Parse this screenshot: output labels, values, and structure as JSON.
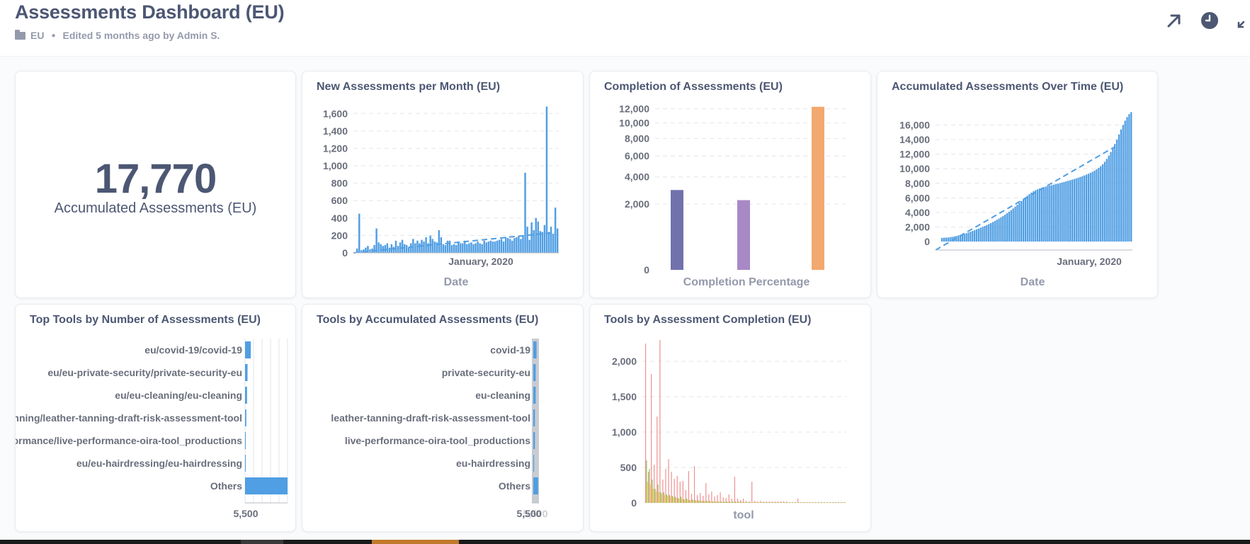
{
  "dashboard": {
    "title": "Assessments Dashboard (EU)",
    "collection": "EU",
    "edited": "Edited 5 months ago by Admin S."
  },
  "header_icons": [
    "arrow-up-right-icon",
    "clock-icon",
    "fullscreen-icon"
  ],
  "colors": {
    "accent": "#509ee3",
    "text": "#4c5773",
    "muted": "#949aab",
    "purple": "#7172ad",
    "lilac": "#a989c5",
    "orange": "#f2a86f",
    "red": "#ef8c8c",
    "green": "#88bf4d",
    "yellow": "#f9d45c"
  },
  "scalar": {
    "value": "17,770",
    "label": "Accumulated Assessments (EU)"
  },
  "charts": {
    "new_per_month": {
      "title": "New Assessments per Month (EU)",
      "xlabel": "Date",
      "x_tick": "January, 2020",
      "y_ticks": [
        "0",
        "200",
        "400",
        "600",
        "800",
        "1,000",
        "1,200",
        "1,400",
        "1,600"
      ]
    },
    "completion": {
      "title": "Completion of Assessments (EU)",
      "xlabel": "Completion Percentage",
      "y_ticks": [
        "0",
        "2,000",
        "4,000",
        "6,000",
        "8,000",
        "10,000",
        "12,000"
      ]
    },
    "accumulated": {
      "title": "Accumulated Assessments Over Time (EU)",
      "xlabel": "Date",
      "x_tick": "January, 2020",
      "y_ticks": [
        "0",
        "2,000",
        "4,000",
        "6,000",
        "8,000",
        "10,000",
        "12,000",
        "14,000",
        "16,000"
      ]
    },
    "top_tools": {
      "title": "Top Tools by Number of Assessments (EU)",
      "labels": [
        "eu/covid-19/covid-19",
        "eu/eu-private-security/private-security-eu",
        "eu/eu-cleaning/eu-cleaning",
        "eu/leather-tanning/leather-tanning-draft-risk-assessment-tool",
        "eu/live-performance/live-performance-oira-tool_productions",
        "eu/eu-hairdressing/eu-hairdressing",
        "Others"
      ],
      "x_tick": "5,500"
    },
    "tools_accumulated": {
      "title": "Tools by Accumulated Assessments (EU)",
      "labels": [
        "covid-19",
        "private-security-eu",
        "eu-cleaning",
        "leather-tanning-draft-risk-assessment-tool",
        "live-performance-oira-tool_productions",
        "eu-hairdressing",
        "Others"
      ],
      "x_tick": "5,500"
    },
    "tools_completion": {
      "title": "Tools by Assessment Completion (EU)",
      "xlabel": "tool",
      "y_ticks": [
        "0",
        "500",
        "1,000",
        "1,500",
        "2,000"
      ]
    }
  },
  "chart_data": [
    {
      "type": "bar",
      "title": "New Assessments per Month (EU)",
      "xlabel": "Date",
      "ylabel": "",
      "ylim": [
        0,
        1700
      ],
      "trend_line": true,
      "values": [
        50,
        450,
        30,
        40,
        60,
        80,
        40,
        50,
        90,
        280,
        120,
        100,
        80,
        90,
        110,
        60,
        100,
        70,
        140,
        80,
        120,
        150,
        100,
        90,
        60,
        110,
        160,
        110,
        140,
        110,
        150,
        130,
        180,
        110,
        200,
        160,
        130,
        120,
        260,
        180,
        100,
        90,
        140,
        140,
        90,
        100,
        90,
        130,
        110,
        110,
        140,
        100,
        110,
        120,
        100,
        110,
        130,
        110,
        100,
        140,
        120,
        130,
        140,
        130,
        130,
        140,
        150,
        160,
        130,
        180,
        170,
        160,
        140,
        170,
        180,
        190,
        160,
        200,
        920,
        300,
        150,
        350,
        260,
        400,
        360,
        250,
        240,
        320,
        1680,
        240,
        300,
        220,
        520,
        280
      ]
    },
    {
      "type": "bar",
      "title": "Completion of Assessments (EU)",
      "xlabel": "Completion Percentage",
      "ylabel": "",
      "y_scale": "sqrt",
      "categories": [
        "",
        "",
        ""
      ],
      "values": [
        2950,
        2250,
        12300
      ],
      "colors": [
        "#7172ad",
        "#a989c5",
        "#f2a86f"
      ]
    },
    {
      "type": "bar",
      "title": "Accumulated Assessments Over Time (EU)",
      "xlabel": "Date",
      "ylabel": "",
      "ylim": [
        0,
        17800
      ],
      "trend_line": true,
      "values": [
        500,
        520,
        540,
        560,
        600,
        650,
        700,
        760,
        830,
        900,
        980,
        1060,
        1150,
        1250,
        1350,
        1450,
        1560,
        1670,
        1780,
        1900,
        2020,
        2140,
        2270,
        2400,
        2540,
        2680,
        2830,
        2990,
        3150,
        3320,
        3500,
        3690,
        3890,
        4100,
        4320,
        4550,
        4790,
        5040,
        5300,
        5550,
        5800,
        6050,
        6300,
        6520,
        6720,
        6900,
        7050,
        7170,
        7280,
        7380,
        7460,
        7540,
        7610,
        7680,
        7750,
        7820,
        7890,
        7960,
        8030,
        8100,
        8180,
        8260,
        8340,
        8420,
        8500,
        8590,
        8680,
        8770,
        8870,
        8970,
        9080,
        9190,
        9310,
        9440,
        9580,
        9740,
        9920,
        10120,
        10350,
        10620,
        10950,
        11350,
        11800,
        12300,
        12800,
        13400,
        14000,
        14700,
        15400,
        16000,
        16600,
        17100,
        17500,
        17770
      ]
    },
    {
      "type": "bar",
      "orientation": "horizontal",
      "title": "Top Tools by Number of Assessments (EU)",
      "categories": [
        "eu/covid-19/covid-19",
        "eu/eu-private-security/private-security-eu",
        "eu/eu-cleaning/eu-cleaning",
        "eu/leather-tanning/leather-tanning-draft-risk-assessment-tool",
        "eu/live-performance/live-performance-oira-tool_productions",
        "eu/eu-hairdressing/eu-hairdressing",
        "Others"
      ],
      "values": [
        5530,
        5400,
        5380,
        5350,
        5320,
        5300,
        7000
      ],
      "x_tick": 5500
    },
    {
      "type": "bar",
      "orientation": "horizontal",
      "title": "Tools by Accumulated Assessments (EU)",
      "categories": [
        "covid-19",
        "private-security-eu",
        "eu-cleaning",
        "leather-tanning-draft-risk-assessment-tool",
        "live-performance-oira-tool_productions",
        "eu-hairdressing",
        "Others"
      ],
      "values": [
        5540,
        5530,
        5530,
        5520,
        5520,
        5510,
        5560
      ],
      "x_tick": 5500
    },
    {
      "type": "bar",
      "title": "Tools by Assessment Completion (EU)",
      "xlabel": "tool",
      "ylabel": "",
      "ylim": [
        0,
        2400
      ],
      "series": [
        {
          "color": "#ef8c8c",
          "values": [
            2250,
            440,
            1820,
            540,
            1220,
            2300,
            330,
            480,
            620,
            440,
            340,
            380,
            300,
            310,
            180,
            450,
            130,
            520,
            110,
            140,
            100,
            280,
            120,
            160,
            90,
            110,
            150,
            80,
            70,
            120,
            60,
            370,
            60,
            40,
            60,
            30,
            20,
            300,
            30,
            20,
            30,
            20,
            20,
            20,
            20,
            20,
            20,
            20,
            20,
            20,
            10,
            10,
            10,
            60,
            10,
            10,
            10,
            10,
            10,
            10,
            10,
            10,
            10,
            10,
            10,
            10,
            10,
            10,
            10,
            10
          ]
        },
        {
          "color": "#88bf4d",
          "values": [
            600,
            480,
            330,
            200,
            260,
            150,
            150,
            120,
            110,
            100,
            90,
            70,
            90,
            50,
            60,
            40,
            50,
            40,
            40,
            30,
            30,
            30,
            30,
            20,
            20,
            20,
            20,
            20,
            20,
            20,
            20,
            20,
            20,
            20,
            10,
            10,
            10,
            10,
            10,
            10,
            10,
            10,
            10,
            10,
            10,
            10,
            10,
            10,
            10,
            10,
            10,
            10,
            10,
            10,
            10,
            10,
            10,
            10,
            10,
            10,
            10,
            10,
            10,
            10,
            10,
            10,
            10,
            10,
            10,
            10
          ]
        },
        {
          "color": "#f9d45c",
          "values": [
            300,
            260,
            200,
            160,
            150,
            120,
            110,
            100,
            90,
            80,
            70,
            60,
            55,
            50,
            45,
            40,
            35,
            30,
            30,
            25,
            25,
            20,
            20,
            20,
            18,
            16,
            15,
            14,
            13,
            12,
            11,
            10,
            10,
            9,
            9,
            8,
            8,
            7,
            7,
            6,
            6,
            6,
            5,
            5,
            5,
            5,
            4,
            4,
            4,
            4,
            4,
            3,
            3,
            3,
            3,
            3,
            3,
            3,
            3,
            2,
            2,
            2,
            2,
            2,
            2,
            2,
            2,
            2,
            2,
            2
          ]
        }
      ]
    }
  ]
}
